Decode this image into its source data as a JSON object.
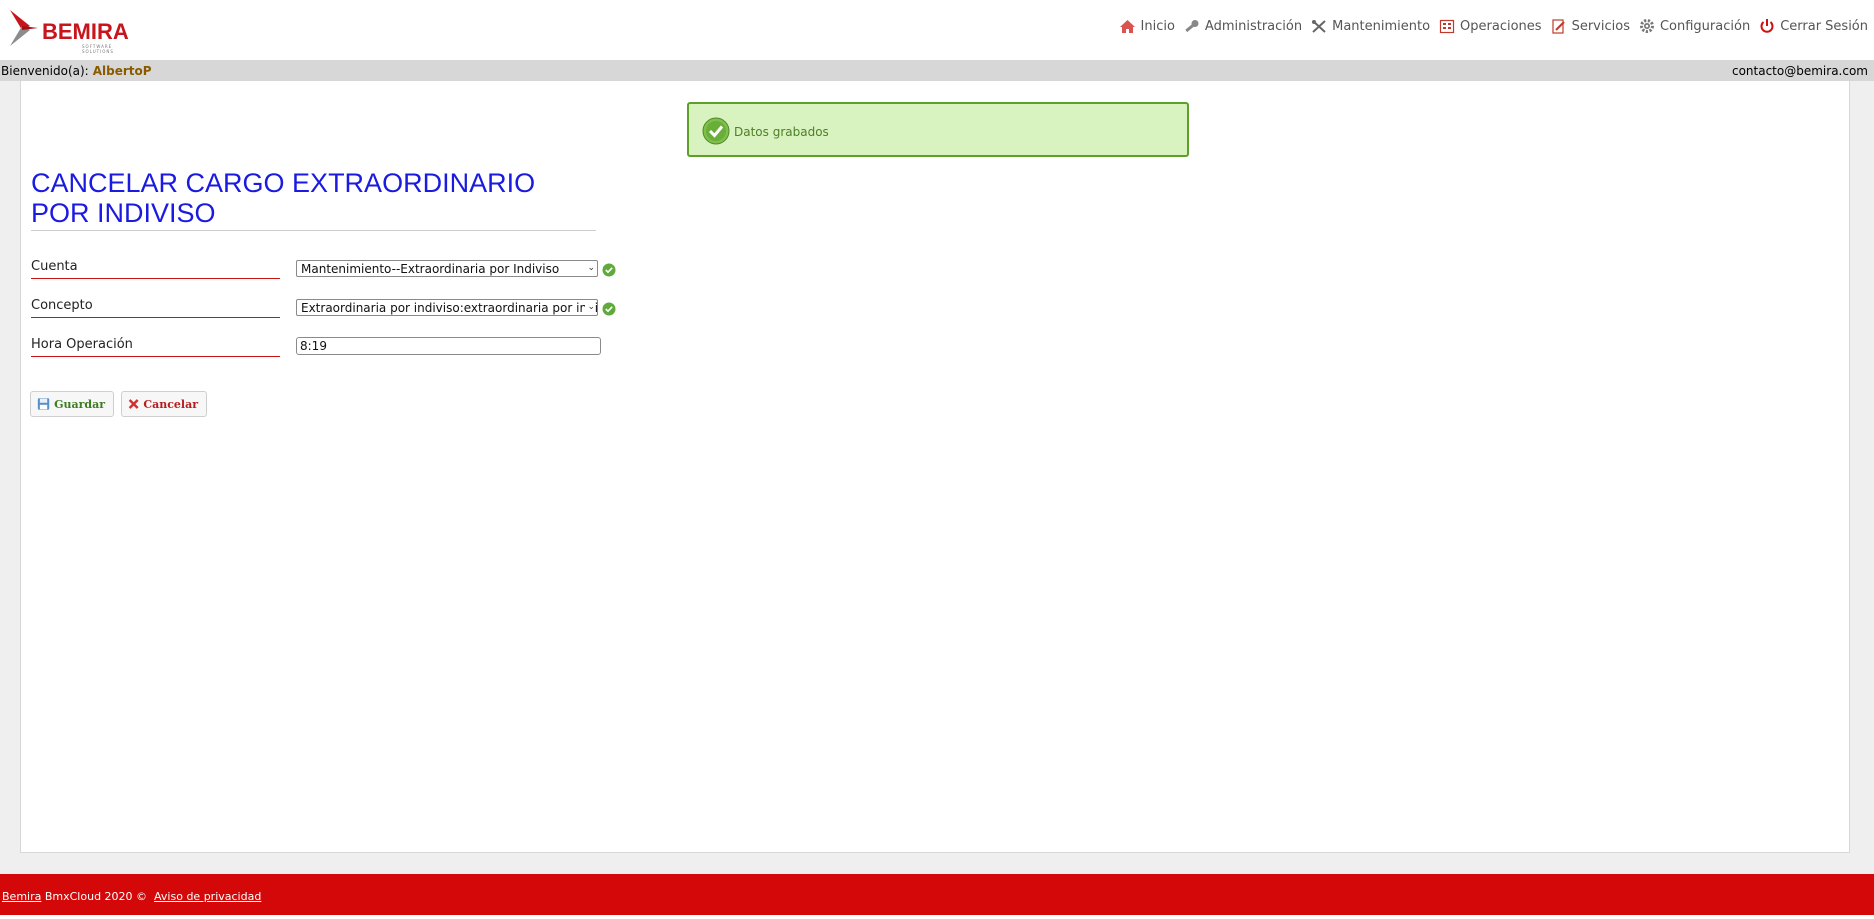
{
  "brand": {
    "name": "BEMIRA",
    "tagline": "SOFTWARE SOLUTIONS"
  },
  "nav": [
    {
      "id": "inicio",
      "label": "Inicio",
      "icon": "home-icon",
      "color": "#d9534f"
    },
    {
      "id": "administracion",
      "label": "Administración",
      "icon": "key-icon",
      "color": "#777777"
    },
    {
      "id": "mantenimiento",
      "label": "Mantenimiento",
      "icon": "tools-icon",
      "color": "#666666"
    },
    {
      "id": "operaciones",
      "label": "Operaciones",
      "icon": "calculator-icon",
      "color": "#c0392b"
    },
    {
      "id": "servicios",
      "label": "Servicios",
      "icon": "document-edit-icon",
      "color": "#c0392b"
    },
    {
      "id": "configuracion",
      "label": "Configuración",
      "icon": "gear-icon",
      "color": "#777777"
    },
    {
      "id": "cerrar",
      "label": "Cerrar Sesión",
      "icon": "power-icon",
      "color": "#cc1111"
    }
  ],
  "welcome": {
    "prefix": "Bienvenido(a):",
    "user": "AlbertoP",
    "contact": "contacto@bemira.com"
  },
  "alert": {
    "message": "Datos grabados"
  },
  "page": {
    "title": "CANCELAR CARGO EXTRAORDINARIO POR INDIVISO"
  },
  "form": {
    "cuenta": {
      "label": "Cuenta",
      "value": "Mantenimiento--Extraordinaria por Indiviso"
    },
    "concepto": {
      "label": "Concepto",
      "value": "Extraordinaria por indiviso:extraordinaria por indiviso"
    },
    "hora": {
      "label": "Hora Operación",
      "value": "8:19"
    }
  },
  "buttons": {
    "save": "Guardar",
    "cancel": "Cancelar"
  },
  "footer": {
    "brand_link": "Bemira",
    "text": "BmxCloud 2020 ©",
    "privacy": "Aviso de privacidad"
  },
  "colors": {
    "footer": "#d40808",
    "title": "#1a1ae0",
    "alert_bg": "#d8f2c0",
    "alert_border": "#5e9f2a"
  }
}
